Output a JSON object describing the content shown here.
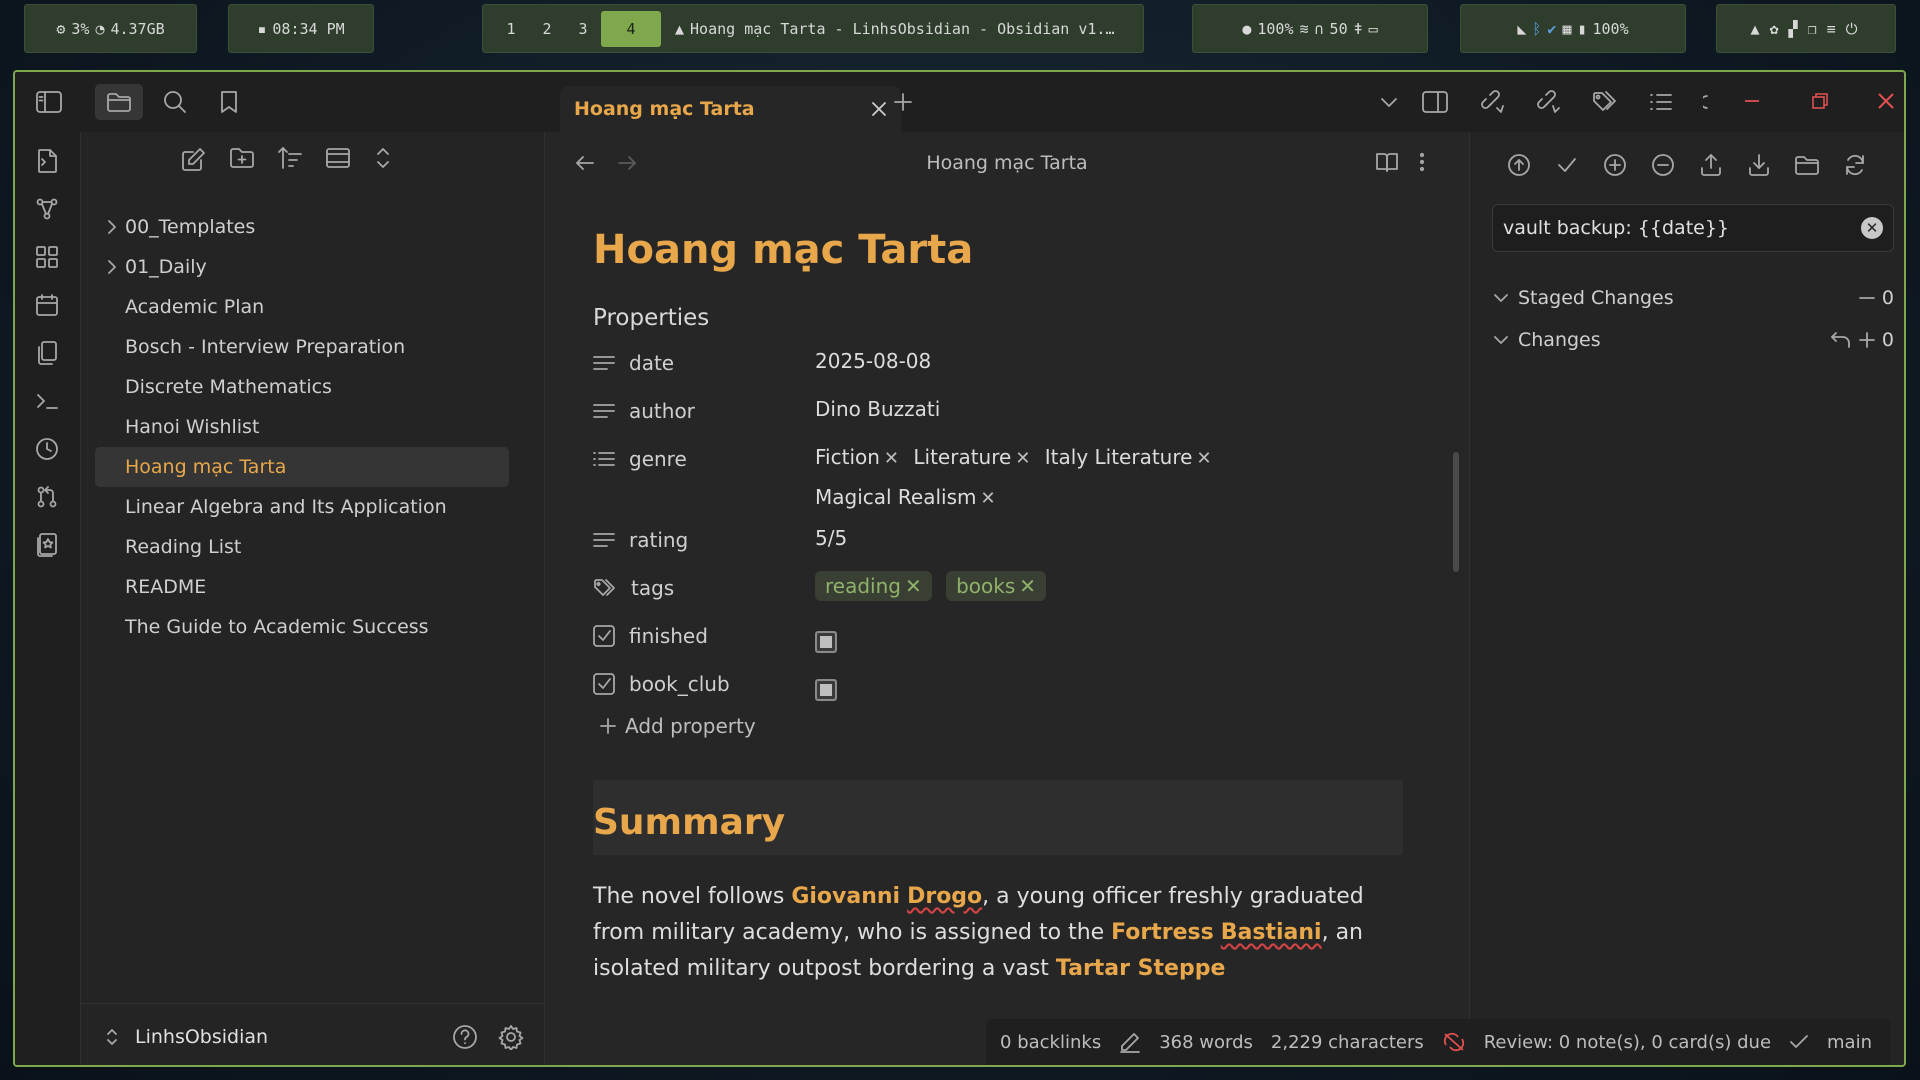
{
  "sysbar": {
    "cpu": "3%",
    "mem": "4.37GB",
    "clock": "08:34 PM",
    "workspaces": [
      "1",
      "2",
      "3",
      "4"
    ],
    "active_workspace": "4",
    "window_title": "Hoang mạc Tarta - LinhsObsidian - Obsidian v1.…",
    "volume": "100%",
    "headphones": "50",
    "battery": "100%"
  },
  "tab": {
    "title": "Hoang mạc Tarta"
  },
  "file_explorer": {
    "items": [
      {
        "label": "00_Templates",
        "type": "folder"
      },
      {
        "label": "01_Daily",
        "type": "folder"
      },
      {
        "label": "Academic Plan",
        "type": "file"
      },
      {
        "label": "Bosch - Interview Preparation",
        "type": "file"
      },
      {
        "label": "Discrete Mathematics",
        "type": "file"
      },
      {
        "label": "Hanoi Wishlist",
        "type": "file"
      },
      {
        "label": "Hoang mạc Tarta",
        "type": "file",
        "active": true
      },
      {
        "label": "Linear Algebra and Its Application",
        "type": "file"
      },
      {
        "label": "Reading List",
        "type": "file"
      },
      {
        "label": "README",
        "type": "file"
      },
      {
        "label": "The Guide to Academic Success",
        "type": "file"
      }
    ],
    "vault_name": "LinhsObsidian"
  },
  "editor": {
    "nav_title": "Hoang mạc Tarta",
    "title": "Hoang mạc Tarta",
    "properties_label": "Properties",
    "properties": {
      "date": {
        "key": "date",
        "value": "2025-08-08"
      },
      "author": {
        "key": "author",
        "value": "Dino Buzzati"
      },
      "genre": {
        "key": "genre",
        "values": [
          "Fiction",
          "Literature",
          "Italy Literature",
          "Magical Realism"
        ]
      },
      "rating": {
        "key": "rating",
        "value": "5/5"
      },
      "tags": {
        "key": "tags",
        "values": [
          "reading",
          "books"
        ]
      },
      "finished": {
        "key": "finished",
        "checked": true
      },
      "book_club": {
        "key": "book_club",
        "checked": true
      }
    },
    "add_property": "Add property",
    "summary_heading": "Summary",
    "summary": {
      "t1": "The novel follows ",
      "name1": "Giovanni",
      "name2": "Drogo",
      "t2": ", a young officer freshly graduated from military academy, who is assigned to the ",
      "place1": "Fortress",
      "place2": "Bastiani",
      "t3": ", an isolated military outpost bordering a vast ",
      "place3": "Tartar Steppe"
    }
  },
  "git": {
    "commit_message": "vault backup: {{date}}",
    "staged_label": "Staged Changes",
    "staged_count": "0",
    "changes_label": "Changes",
    "changes_count": "0"
  },
  "status": {
    "backlinks": "0 backlinks",
    "words": "368 words",
    "characters": "2,229 characters",
    "review": "Review: 0 note(s), 0 card(s) due",
    "branch": "main"
  },
  "colors": {
    "accent": "#e8a74a",
    "focus_border": "#7fa84c",
    "tag_text": "#8fb26b"
  }
}
